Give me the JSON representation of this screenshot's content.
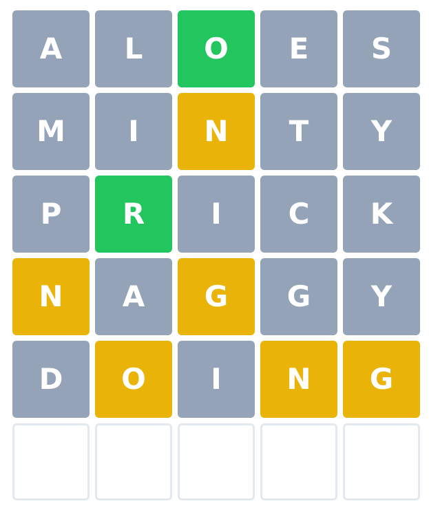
{
  "colors": {
    "absent": "#94a3b8",
    "present": "#eab308",
    "correct": "#22c55e",
    "empty_border": "#e2e8f0"
  },
  "board": {
    "rows": [
      {
        "tiles": [
          {
            "letter": "A",
            "state": "absent"
          },
          {
            "letter": "L",
            "state": "absent"
          },
          {
            "letter": "O",
            "state": "correct"
          },
          {
            "letter": "E",
            "state": "absent"
          },
          {
            "letter": "S",
            "state": "absent"
          }
        ]
      },
      {
        "tiles": [
          {
            "letter": "M",
            "state": "absent"
          },
          {
            "letter": "I",
            "state": "absent"
          },
          {
            "letter": "N",
            "state": "present"
          },
          {
            "letter": "T",
            "state": "absent"
          },
          {
            "letter": "Y",
            "state": "absent"
          }
        ]
      },
      {
        "tiles": [
          {
            "letter": "P",
            "state": "absent"
          },
          {
            "letter": "R",
            "state": "correct"
          },
          {
            "letter": "I",
            "state": "absent"
          },
          {
            "letter": "C",
            "state": "absent"
          },
          {
            "letter": "K",
            "state": "absent"
          }
        ]
      },
      {
        "tiles": [
          {
            "letter": "N",
            "state": "present"
          },
          {
            "letter": "A",
            "state": "absent"
          },
          {
            "letter": "G",
            "state": "present"
          },
          {
            "letter": "G",
            "state": "absent"
          },
          {
            "letter": "Y",
            "state": "absent"
          }
        ]
      },
      {
        "tiles": [
          {
            "letter": "D",
            "state": "absent"
          },
          {
            "letter": "O",
            "state": "present"
          },
          {
            "letter": "I",
            "state": "absent"
          },
          {
            "letter": "N",
            "state": "present"
          },
          {
            "letter": "G",
            "state": "present"
          }
        ]
      },
      {
        "tiles": [
          {
            "letter": "",
            "state": "empty"
          },
          {
            "letter": "",
            "state": "empty"
          },
          {
            "letter": "",
            "state": "empty"
          },
          {
            "letter": "",
            "state": "empty"
          },
          {
            "letter": "",
            "state": "empty"
          }
        ]
      }
    ]
  }
}
